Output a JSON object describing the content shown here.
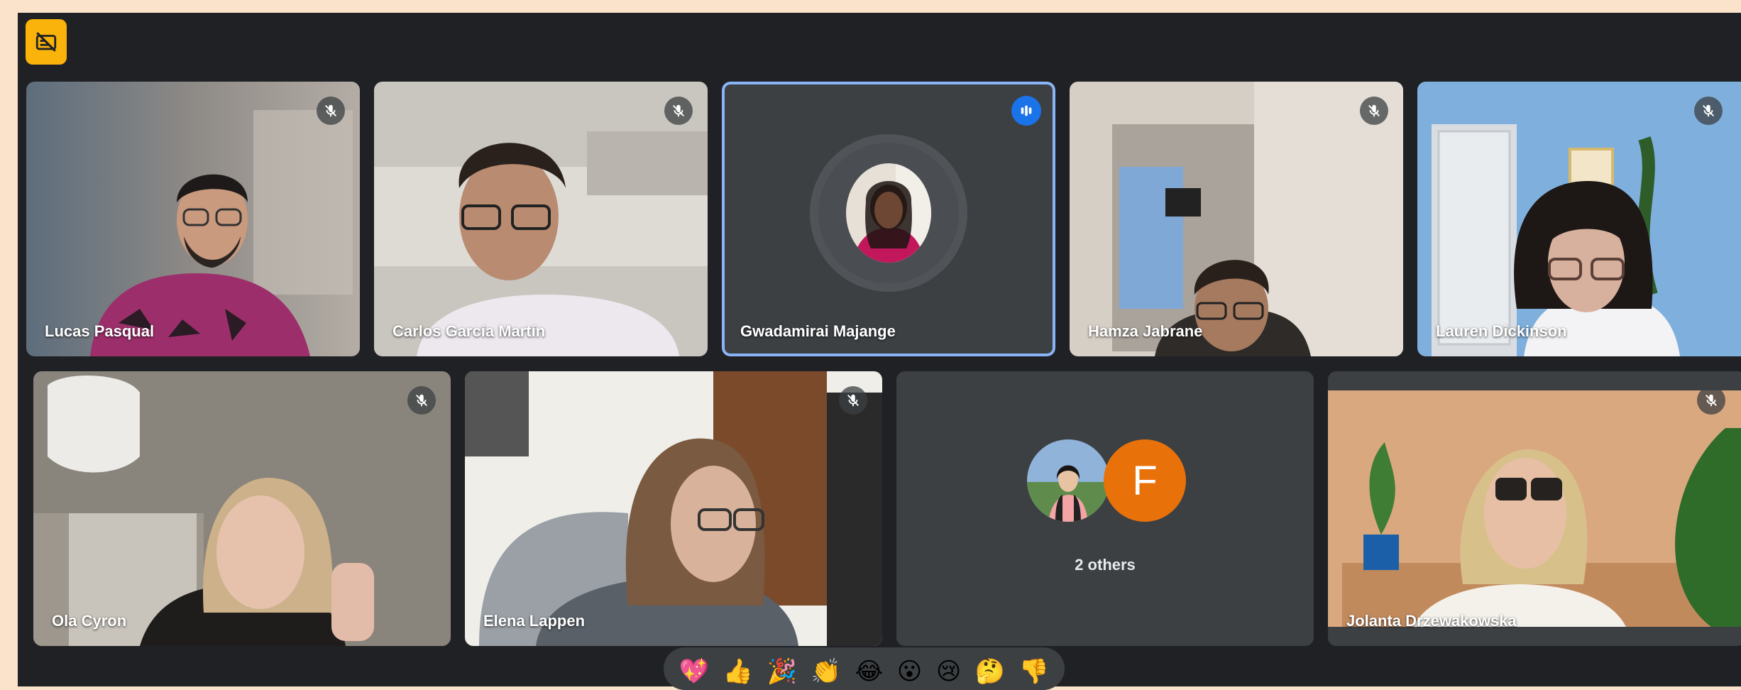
{
  "toolbar": {
    "badge_icon": "captions-off-icon",
    "badge_color": "#f9b30a"
  },
  "participants": [
    {
      "name": "Lucas Pasqual",
      "muted": true
    },
    {
      "name": "Carlos García Martín",
      "muted": true
    },
    {
      "name": "Gwadamirai Majange",
      "muted": false,
      "speaking": true
    },
    {
      "name": "Hamza Jabrane",
      "muted": true
    },
    {
      "name": "Lauren Dickinson",
      "muted": true
    },
    {
      "name": "Ola Cyron",
      "muted": true
    },
    {
      "name": "Elena Lappen",
      "muted": true
    },
    {
      "name": "Jolanta Drzewakowska",
      "muted": true
    }
  ],
  "others_tile": {
    "label": "2 others",
    "letter_avatar": "F",
    "letter_color": "#e8710a"
  },
  "reactions": [
    "💖",
    "👍",
    "🎉",
    "👏",
    "😂",
    "😮",
    "😢",
    "🤔",
    "👎"
  ],
  "colors": {
    "background": "#202124",
    "speaking_ring": "#8ab4f8",
    "speaking_badge": "#1a73e8"
  }
}
